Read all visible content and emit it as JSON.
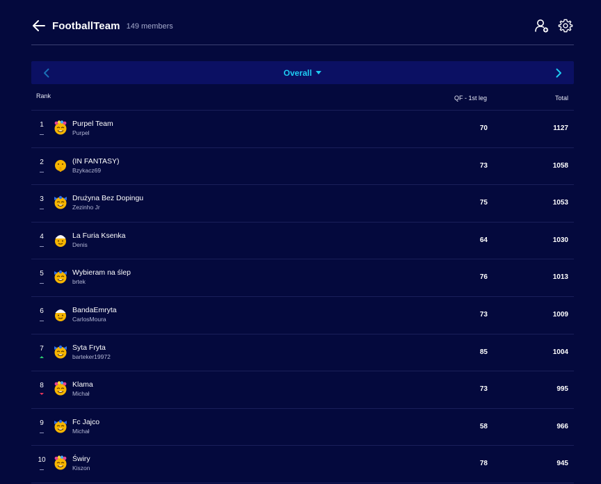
{
  "header": {
    "title": "FootballTeam",
    "members_count": "149",
    "members_label": "members"
  },
  "selector": {
    "label": "Overall"
  },
  "table": {
    "columns": {
      "rank": "Rank",
      "round": "QF - 1st leg",
      "total": "Total"
    },
    "rows": [
      {
        "rank": "1",
        "team": "Purpel Team",
        "manager": "Purpel",
        "round": "70",
        "total": "1127",
        "movement": "same",
        "avatar": "flower-crown-emoji-icon"
      },
      {
        "rank": "2",
        "team": "(IN FANTASY)",
        "manager": "Bzykacz69",
        "round": "73",
        "total": "1058",
        "movement": "same",
        "avatar": "shushing-face-icon"
      },
      {
        "rank": "3",
        "team": "Drużyna Bez Dopingu",
        "manager": "Zezinho Jr",
        "round": "75",
        "total": "1053",
        "movement": "same",
        "avatar": "blue-bow-emoji-icon"
      },
      {
        "rank": "4",
        "team": "La Furia Ksenka",
        "manager": "Denis",
        "round": "64",
        "total": "1030",
        "movement": "same",
        "avatar": "turban-emoji-icon"
      },
      {
        "rank": "5",
        "team": "Wybieram na ślep",
        "manager": "brtek",
        "round": "76",
        "total": "1013",
        "movement": "same",
        "avatar": "blue-bow-emoji-icon"
      },
      {
        "rank": "6",
        "team": "BandaEmryta",
        "manager": "CarlosMoura",
        "round": "73",
        "total": "1009",
        "movement": "same",
        "avatar": "turban-emoji-icon"
      },
      {
        "rank": "7",
        "team": "Syta Fryta",
        "manager": "barteker19972",
        "round": "85",
        "total": "1004",
        "movement": "up",
        "avatar": "blue-bow-emoji-icon"
      },
      {
        "rank": "8",
        "team": "Klama",
        "manager": "Michał",
        "round": "73",
        "total": "995",
        "movement": "down",
        "avatar": "flower-crown-emoji-icon"
      },
      {
        "rank": "9",
        "team": "Fc Jajco",
        "manager": "Michał",
        "round": "58",
        "total": "966",
        "movement": "same",
        "avatar": "blue-bow-emoji-icon"
      },
      {
        "rank": "10",
        "team": "Świry",
        "manager": "Kiszon",
        "round": "78",
        "total": "945",
        "movement": "same",
        "avatar": "flower-crown-emoji-icon"
      }
    ]
  },
  "colors": {
    "background": "#04093d",
    "selector_bg": "#0b1063",
    "accent": "#1ecbf2",
    "up": "#2ecc71",
    "down": "#e8365a"
  }
}
